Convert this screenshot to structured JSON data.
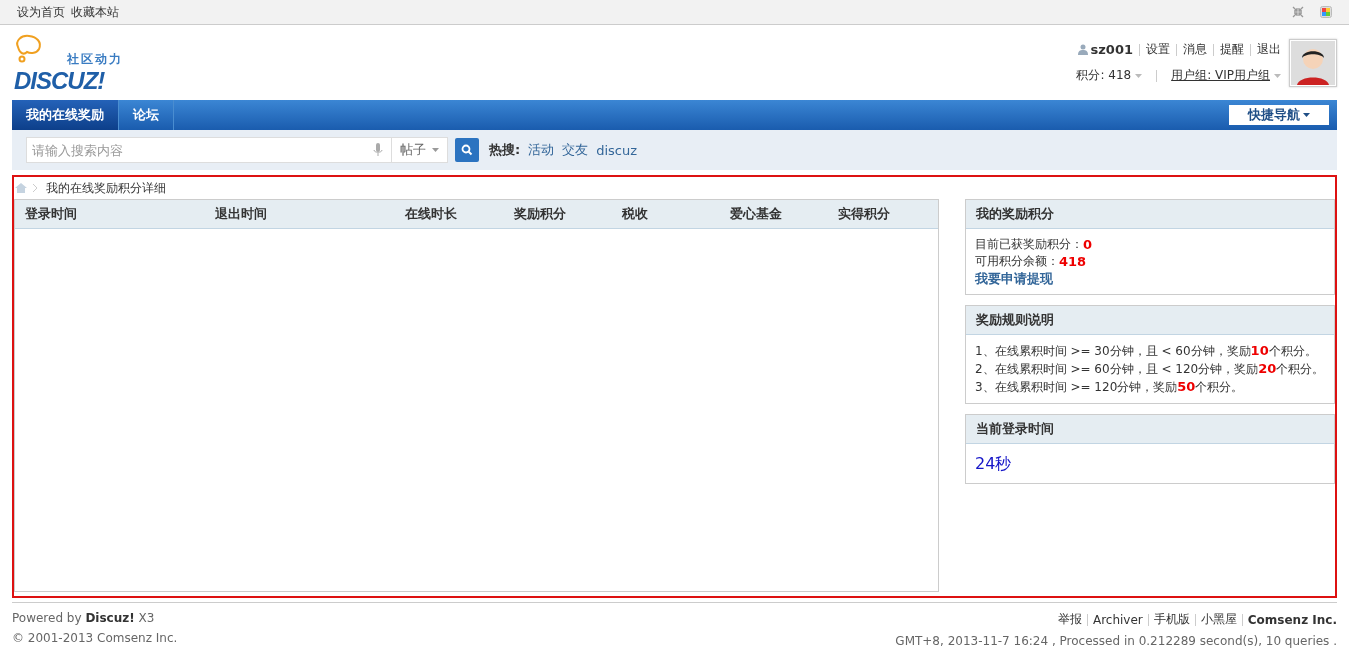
{
  "topbar": {
    "links": [
      "设为首页",
      "收藏本站"
    ]
  },
  "header": {
    "logo": {
      "tagline": "社区动力",
      "wordmark": "DISCUZ!"
    },
    "user": {
      "name": "sz001",
      "links": [
        "设置",
        "消息",
        "提醒",
        "退出"
      ],
      "credits": "积分: 418",
      "usergroup": "用户组: VIP用户组"
    }
  },
  "nav": {
    "items": [
      {
        "label": "我的在线奖励",
        "selected": true
      },
      {
        "label": "论坛",
        "selected": false
      }
    ],
    "quick_nav": "快捷导航"
  },
  "search": {
    "placeholder": "请输入搜索内容",
    "type": "帖子",
    "hot_label": "热搜:",
    "hot_terms": [
      "活动",
      "交友",
      "discuz"
    ]
  },
  "breadcrumb": "我的在线奖励积分详细",
  "table": {
    "columns": [
      "登录时间",
      "退出时间",
      "在线时长",
      "奖励积分",
      "税收",
      "爱心基金",
      "实得积分"
    ]
  },
  "sidebar": [
    {
      "kind": "reward",
      "title": "我的奖励积分",
      "lines": [
        {
          "label": "目前已获奖励积分：",
          "value": "0"
        },
        {
          "label": "可用积分余额：",
          "value": "418"
        }
      ],
      "link": "我要申请提现"
    },
    {
      "kind": "rules",
      "title": "奖励规则说明",
      "rules": [
        "1、在线累积时间 >= 30分钟，且 < 60分钟，奖励**10**个积分。",
        "2、在线累积时间 >= 60分钟，且 < 120分钟，奖励**20**个积分。",
        "3、在线累积时间 >= 120分钟，奖励**50**个积分。"
      ]
    },
    {
      "kind": "time",
      "title": "当前登录时间",
      "value": "24秒"
    }
  ],
  "footer": {
    "powered_by": "Powered by **Discuz!** X3",
    "copyright": "© 2001-2013 Comsenz Inc.",
    "links": [
      {
        "label": "举报",
        "kind": "plain"
      },
      {
        "label": "Archiver",
        "kind": "plain"
      },
      {
        "label": "手机版",
        "kind": "plain"
      },
      {
        "label": "小黑屋",
        "kind": "plain"
      },
      {
        "label": "Comsenz Inc.",
        "kind": "company"
      }
    ],
    "status": "GMT+8, 2013-11-7 16:24 , Processed in 0.212289 second(s), 10 queries ."
  }
}
